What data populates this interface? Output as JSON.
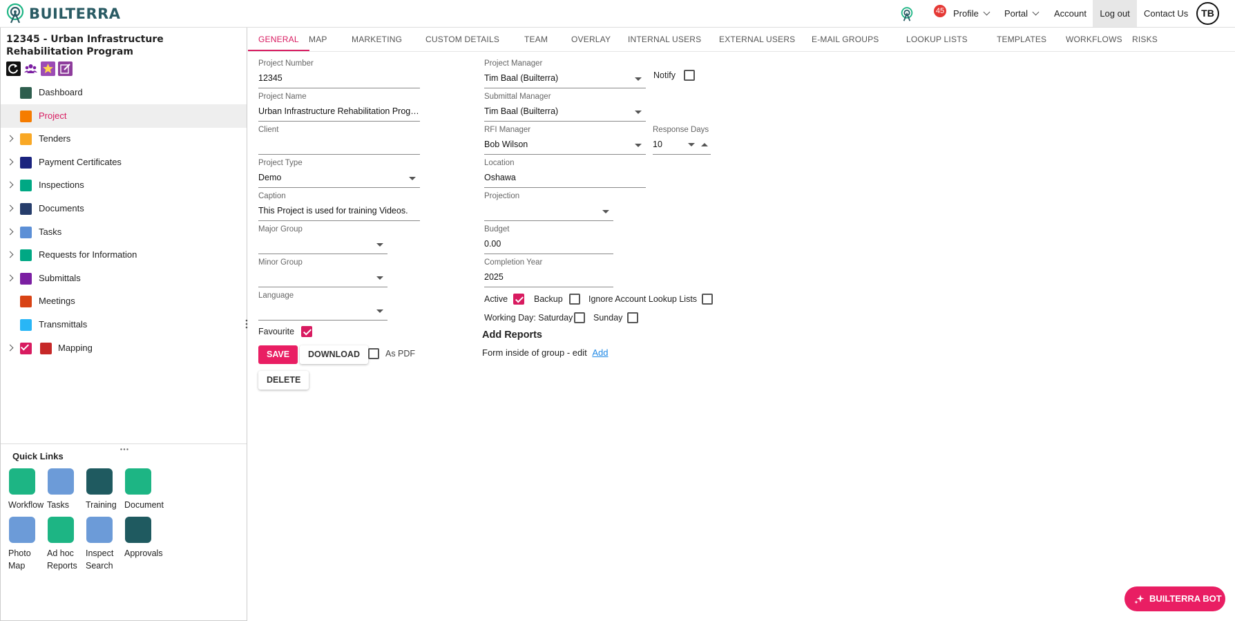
{
  "header": {
    "logo_text": "BUILTERRA",
    "notification_count": "45",
    "nav": {
      "profile": "Profile",
      "portal": "Portal",
      "account": "Account",
      "logout": "Log out",
      "contact": "Contact Us"
    },
    "avatar_initials": "TB"
  },
  "sidebar": {
    "project_title": "12345 - Urban Infrastructure Rehabilitation Program",
    "items": [
      {
        "label": "Dashboard",
        "expandable": false,
        "color": "#2e5e4e"
      },
      {
        "label": "Project",
        "expandable": false,
        "color": "#f57c00",
        "selected": true
      },
      {
        "label": "Tenders",
        "expandable": true,
        "color": "#f9a825"
      },
      {
        "label": "Payment Certificates",
        "expandable": true,
        "color": "#1a237e"
      },
      {
        "label": "Inspections",
        "expandable": true,
        "color": "#00a884"
      },
      {
        "label": "Documents",
        "expandable": true,
        "color": "#263d6b"
      },
      {
        "label": "Tasks",
        "expandable": true,
        "color": "#5c8fd6"
      },
      {
        "label": "Requests for Information",
        "expandable": true,
        "color": "#00a884"
      },
      {
        "label": "Submittals",
        "expandable": true,
        "color": "#7b1fa2"
      },
      {
        "label": "Meetings",
        "expandable": false,
        "color": "#d84315"
      },
      {
        "label": "Transmittals",
        "expandable": false,
        "color": "#29b6f6"
      },
      {
        "label": "Mapping",
        "expandable": true,
        "color": "#c62828"
      }
    ]
  },
  "quick_links": {
    "title": "Quick Links",
    "items": [
      {
        "label": "Workflow",
        "color": "#1db584"
      },
      {
        "label": "Tasks",
        "color": "#6c9bd8"
      },
      {
        "label": "Training",
        "color": "#1f5a60"
      },
      {
        "label": "Document",
        "color": "#1db584"
      },
      {
        "label": "Photo Map",
        "color": "#6c9bd8"
      },
      {
        "label": "Ad hoc Reports",
        "color": "#1db584"
      },
      {
        "label": "Inspect Search",
        "color": "#6c9bd8"
      },
      {
        "label": "Approvals",
        "color": "#1f5a60"
      }
    ]
  },
  "tabs": [
    "GENERAL",
    "MAP",
    "MARKETING",
    "CUSTOM DETAILS",
    "TEAM",
    "OVERLAY",
    "INTERNAL USERS",
    "EXTERNAL USERS",
    "E-MAIL GROUPS",
    "LOOKUP LISTS",
    "TEMPLATES",
    "WORKFLOWS",
    "RISKS"
  ],
  "form": {
    "project_number": {
      "label": "Project Number",
      "value": "12345"
    },
    "project_name": {
      "label": "Project Name",
      "value": "Urban Infrastructure Rehabilitation Program"
    },
    "client": {
      "label": "Client",
      "value": ""
    },
    "project_type": {
      "label": "Project Type",
      "value": "Demo"
    },
    "caption": {
      "label": "Caption",
      "value": "This Project is used for training Videos."
    },
    "major_group": {
      "label": "Major Group",
      "value": ""
    },
    "minor_group": {
      "label": "Minor Group",
      "value": ""
    },
    "language": {
      "label": "Language",
      "value": ""
    },
    "favourite": {
      "label": "Favourite",
      "checked": true
    },
    "project_manager": {
      "label": "Project Manager",
      "value": "Tim Baal (Builterra)"
    },
    "notify": {
      "label": "Notify",
      "checked": false
    },
    "submittal_manager": {
      "label": "Submittal Manager",
      "value": "Tim Baal (Builterra)"
    },
    "rfi_manager": {
      "label": "RFI Manager",
      "value": "Bob Wilson"
    },
    "response_days": {
      "label": "Response Days",
      "value": "10"
    },
    "location": {
      "label": "Location",
      "value": "Oshawa"
    },
    "projection": {
      "label": "Projection",
      "value": ""
    },
    "budget": {
      "label": "Budget",
      "value": "0.00"
    },
    "completion_year": {
      "label": "Completion Year",
      "value": "2025"
    },
    "active": {
      "label": "Active",
      "checked": true
    },
    "backup": {
      "label": "Backup",
      "checked": false
    },
    "ignore_lookup": {
      "label": "Ignore Account Lookup Lists",
      "checked": false
    },
    "working_saturday": {
      "label": "Working Day: Saturday",
      "checked": false
    },
    "sunday": {
      "label": "Sunday",
      "checked": false
    }
  },
  "buttons": {
    "save": "SAVE",
    "download": "DOWNLOAD",
    "as_pdf": "As PDF",
    "delete": "DELETE"
  },
  "reports": {
    "title": "Add Reports",
    "text": "Form inside of group - edit",
    "link": "Add"
  },
  "bot": {
    "label": "BUILTERRA BOT"
  },
  "colors": {
    "accent": "#e91e63",
    "brand": "#2a5b64"
  }
}
